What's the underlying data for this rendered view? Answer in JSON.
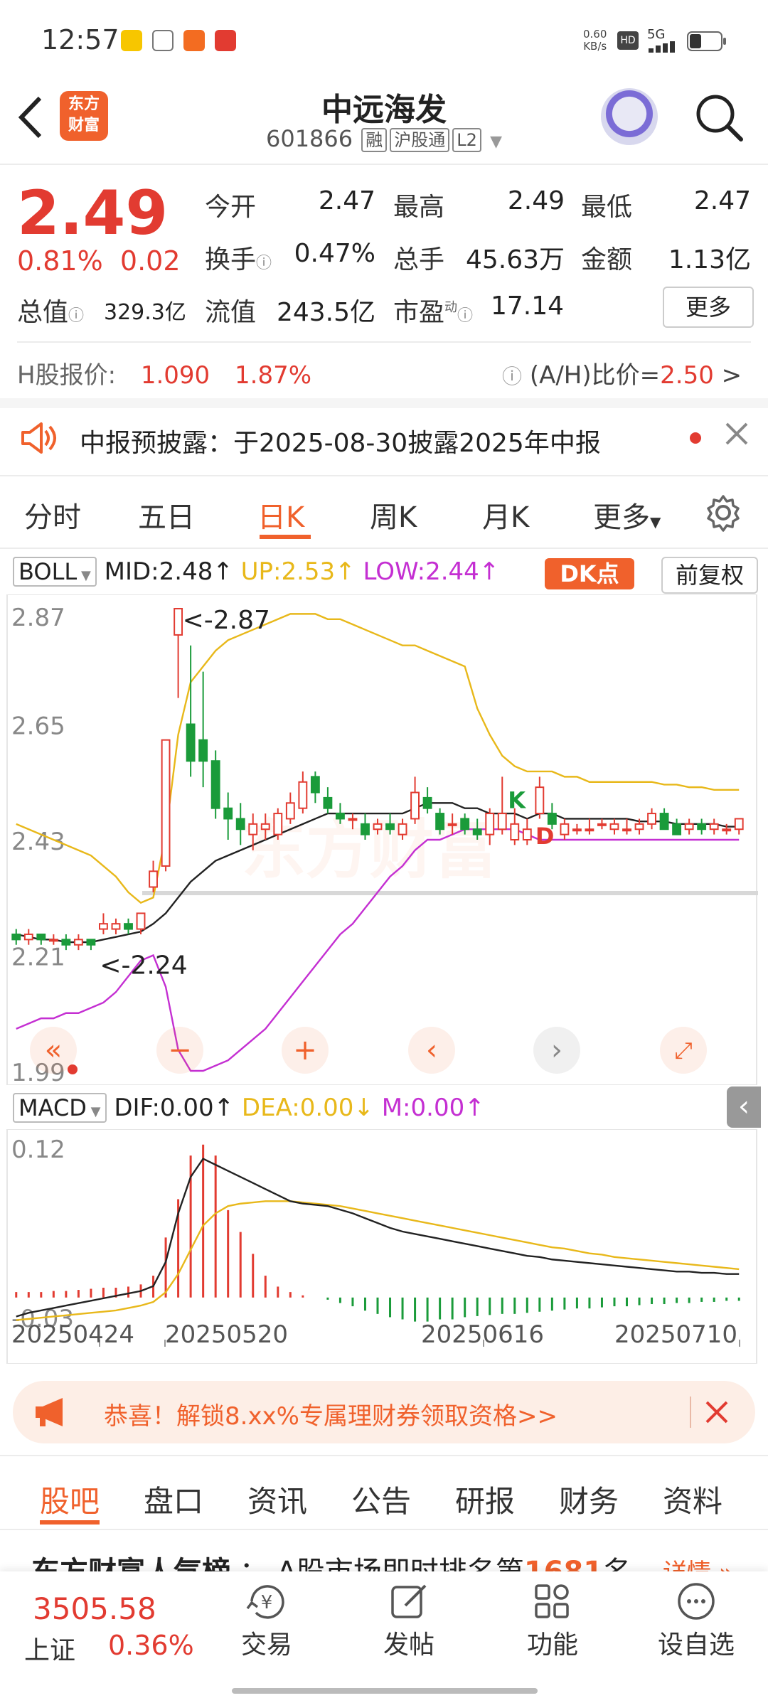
{
  "status": {
    "time": "12:57",
    "net_speed_top": "0.60",
    "net_speed_bottom": "KB/s",
    "hd": "HD",
    "net": "5G"
  },
  "header": {
    "back_label": "<",
    "logo_line1": "东方",
    "logo_line2": "财富",
    "title": "中远海发",
    "code": "601866",
    "tag1": "融",
    "tag2": "沪股通",
    "tag3": "L2"
  },
  "quote": {
    "price": "2.49",
    "pct": "0.81%",
    "chg": "0.02",
    "open_label": "今开",
    "open": "2.47",
    "high_label": "最高",
    "high": "2.49",
    "low_label": "最低",
    "low": "2.47",
    "turnover_label": "换手",
    "turnover": "0.47%",
    "volume_label": "总手",
    "volume": "45.63万",
    "amount_label": "金额",
    "amount": "1.13亿",
    "mktcap_label": "总值",
    "mktcap": "329.3亿",
    "float_label": "流值",
    "float": "243.5亿",
    "pe_label": "市盈",
    "pe_sup": "动",
    "pe": "17.14",
    "more": "更多"
  },
  "hshare": {
    "label": "H股报价:",
    "price": "1.090",
    "pct": "1.87%",
    "ah_label": "(A/H)比价=",
    "ah_value": "2.50",
    "arrow": ">"
  },
  "notice": {
    "text": "中报预披露：于2025-08-30披露2025年中报"
  },
  "ktabs": [
    "分时",
    "五日",
    "日K",
    "周K",
    "月K",
    "更多"
  ],
  "boll": {
    "name": "BOLL",
    "mid": "MID:2.48",
    "up": "UP:2.53",
    "low": "LOW:2.44",
    "dk": "DK点",
    "fq": "前复权"
  },
  "chart_data": [
    {
      "type": "candlestick",
      "title": "BOLL",
      "y_ticks": [
        "2.87",
        "2.65",
        "2.43",
        "2.21",
        "1.99"
      ],
      "ylim": [
        1.99,
        2.87
      ],
      "annotations": [
        "<-2.87",
        "<-2.24",
        "K",
        "D"
      ],
      "candles": [
        {
          "o": 2.25,
          "c": 2.24,
          "h": 2.26,
          "l": 2.23
        },
        {
          "o": 2.24,
          "c": 2.25,
          "h": 2.26,
          "l": 2.23
        },
        {
          "o": 2.25,
          "c": 2.24,
          "h": 2.25,
          "l": 2.23
        },
        {
          "o": 2.24,
          "c": 2.24,
          "h": 2.25,
          "l": 2.23
        },
        {
          "o": 2.24,
          "c": 2.23,
          "h": 2.25,
          "l": 2.22
        },
        {
          "o": 2.23,
          "c": 2.24,
          "h": 2.25,
          "l": 2.22
        },
        {
          "o": 2.24,
          "c": 2.23,
          "h": 2.24,
          "l": 2.22
        },
        {
          "o": 2.26,
          "c": 2.27,
          "h": 2.29,
          "l": 2.25
        },
        {
          "o": 2.26,
          "c": 2.27,
          "h": 2.28,
          "l": 2.25
        },
        {
          "o": 2.27,
          "c": 2.26,
          "h": 2.28,
          "l": 2.25
        },
        {
          "o": 2.26,
          "c": 2.29,
          "h": 2.29,
          "l": 2.25
        },
        {
          "o": 2.34,
          "c": 2.37,
          "h": 2.39,
          "l": 2.33
        },
        {
          "o": 2.38,
          "c": 2.62,
          "h": 2.62,
          "l": 2.37
        },
        {
          "o": 2.82,
          "c": 2.87,
          "h": 2.87,
          "l": 2.7
        },
        {
          "o": 2.65,
          "c": 2.58,
          "h": 2.8,
          "l": 2.55
        },
        {
          "o": 2.62,
          "c": 2.58,
          "h": 2.75,
          "l": 2.53
        },
        {
          "o": 2.58,
          "c": 2.49,
          "h": 2.6,
          "l": 2.47
        },
        {
          "o": 2.49,
          "c": 2.47,
          "h": 2.52,
          "l": 2.43
        },
        {
          "o": 2.47,
          "c": 2.45,
          "h": 2.5,
          "l": 2.42
        },
        {
          "o": 2.44,
          "c": 2.46,
          "h": 2.48,
          "l": 2.41
        },
        {
          "o": 2.45,
          "c": 2.46,
          "h": 2.48,
          "l": 2.43
        },
        {
          "o": 2.44,
          "c": 2.48,
          "h": 2.49,
          "l": 2.43
        },
        {
          "o": 2.47,
          "c": 2.5,
          "h": 2.52,
          "l": 2.46
        },
        {
          "o": 2.49,
          "c": 2.54,
          "h": 2.56,
          "l": 2.48
        },
        {
          "o": 2.55,
          "c": 2.52,
          "h": 2.56,
          "l": 2.5
        },
        {
          "o": 2.51,
          "c": 2.49,
          "h": 2.53,
          "l": 2.48
        },
        {
          "o": 2.48,
          "c": 2.47,
          "h": 2.5,
          "l": 2.46
        },
        {
          "o": 2.47,
          "c": 2.47,
          "h": 2.48,
          "l": 2.45
        },
        {
          "o": 2.46,
          "c": 2.44,
          "h": 2.48,
          "l": 2.43
        },
        {
          "o": 2.45,
          "c": 2.46,
          "h": 2.47,
          "l": 2.44
        },
        {
          "o": 2.46,
          "c": 2.45,
          "h": 2.48,
          "l": 2.44
        },
        {
          "o": 2.44,
          "c": 2.46,
          "h": 2.47,
          "l": 2.43
        },
        {
          "o": 2.47,
          "c": 2.52,
          "h": 2.55,
          "l": 2.46
        },
        {
          "o": 2.51,
          "c": 2.49,
          "h": 2.53,
          "l": 2.48
        },
        {
          "o": 2.48,
          "c": 2.45,
          "h": 2.49,
          "l": 2.44
        },
        {
          "o": 2.46,
          "c": 2.46,
          "h": 2.48,
          "l": 2.44
        },
        {
          "o": 2.47,
          "c": 2.45,
          "h": 2.48,
          "l": 2.44
        },
        {
          "o": 2.45,
          "c": 2.44,
          "h": 2.47,
          "l": 2.43
        },
        {
          "o": 2.44,
          "c": 2.48,
          "h": 2.49,
          "l": 2.42
        },
        {
          "o": 2.45,
          "c": 2.48,
          "h": 2.55,
          "l": 2.44
        },
        {
          "o": 2.43,
          "c": 2.46,
          "h": 2.49,
          "l": 2.42
        },
        {
          "o": 2.43,
          "c": 2.45,
          "h": 2.47,
          "l": 2.42
        },
        {
          "o": 2.48,
          "c": 2.53,
          "h": 2.55,
          "l": 2.47
        },
        {
          "o": 2.48,
          "c": 2.46,
          "h": 2.5,
          "l": 2.45
        },
        {
          "o": 2.44,
          "c": 2.46,
          "h": 2.47,
          "l": 2.43
        },
        {
          "o": 2.45,
          "c": 2.45,
          "h": 2.46,
          "l": 2.44
        },
        {
          "o": 2.45,
          "c": 2.45,
          "h": 2.47,
          "l": 2.44
        },
        {
          "o": 2.46,
          "c": 2.46,
          "h": 2.47,
          "l": 2.45
        },
        {
          "o": 2.45,
          "c": 2.46,
          "h": 2.47,
          "l": 2.44
        },
        {
          "o": 2.45,
          "c": 2.45,
          "h": 2.47,
          "l": 2.44
        },
        {
          "o": 2.45,
          "c": 2.46,
          "h": 2.47,
          "l": 2.44
        },
        {
          "o": 2.46,
          "c": 2.48,
          "h": 2.49,
          "l": 2.45
        },
        {
          "o": 2.48,
          "c": 2.45,
          "h": 2.49,
          "l": 2.45
        },
        {
          "o": 2.46,
          "c": 2.44,
          "h": 2.47,
          "l": 2.44
        },
        {
          "o": 2.45,
          "c": 2.46,
          "h": 2.47,
          "l": 2.44
        },
        {
          "o": 2.46,
          "c": 2.45,
          "h": 2.47,
          "l": 2.44
        },
        {
          "o": 2.45,
          "c": 2.46,
          "h": 2.47,
          "l": 2.44
        },
        {
          "o": 2.45,
          "c": 2.45,
          "h": 2.46,
          "l": 2.44
        },
        {
          "o": 2.45,
          "c": 2.47,
          "h": 2.47,
          "l": 2.44
        }
      ],
      "mid": [
        2.25,
        2.245,
        2.24,
        2.24,
        2.235,
        2.235,
        2.235,
        2.24,
        2.245,
        2.25,
        2.255,
        2.27,
        2.29,
        2.32,
        2.35,
        2.37,
        2.39,
        2.4,
        2.41,
        2.42,
        2.43,
        2.44,
        2.45,
        2.46,
        2.47,
        2.48,
        2.48,
        2.48,
        2.48,
        2.48,
        2.48,
        2.48,
        2.49,
        2.5,
        2.5,
        2.5,
        2.49,
        2.49,
        2.48,
        2.48,
        2.48,
        2.47,
        2.48,
        2.48,
        2.47,
        2.47,
        2.47,
        2.47,
        2.47,
        2.47,
        2.465,
        2.465,
        2.465,
        2.46,
        2.46,
        2.46,
        2.46,
        2.455,
        2.455
      ],
      "up": [
        2.46,
        2.45,
        2.44,
        2.43,
        2.42,
        2.41,
        2.4,
        2.38,
        2.36,
        2.33,
        2.31,
        2.32,
        2.44,
        2.63,
        2.73,
        2.76,
        2.79,
        2.81,
        2.82,
        2.83,
        2.84,
        2.85,
        2.86,
        2.86,
        2.86,
        2.85,
        2.85,
        2.84,
        2.83,
        2.82,
        2.81,
        2.8,
        2.8,
        2.79,
        2.78,
        2.77,
        2.76,
        2.68,
        2.63,
        2.59,
        2.57,
        2.56,
        2.56,
        2.56,
        2.55,
        2.55,
        2.54,
        2.54,
        2.54,
        2.54,
        2.54,
        2.54,
        2.535,
        2.535,
        2.53,
        2.53,
        2.525,
        2.525,
        2.525
      ],
      "low": [
        2.07,
        2.08,
        2.09,
        2.09,
        2.1,
        2.1,
        2.11,
        2.12,
        2.14,
        2.17,
        2.2,
        2.21,
        2.15,
        2.03,
        1.99,
        1.99,
        2.0,
        2.01,
        2.03,
        2.05,
        2.07,
        2.1,
        2.13,
        2.16,
        2.19,
        2.22,
        2.25,
        2.27,
        2.3,
        2.33,
        2.36,
        2.38,
        2.41,
        2.43,
        2.43,
        2.44,
        2.45,
        2.45,
        2.45,
        2.45,
        2.45,
        2.44,
        2.43,
        2.43,
        2.43,
        2.43,
        2.43,
        2.43,
        2.43,
        2.43,
        2.43,
        2.43,
        2.43,
        2.43,
        2.43,
        2.43,
        2.43,
        2.43,
        2.43
      ]
    },
    {
      "type": "bar",
      "title": "MACD",
      "y_ticks": [
        "0.12",
        "-0.03"
      ],
      "ylim": [
        -0.03,
        0.12
      ],
      "x_labels": [
        "20250424",
        "20250520",
        "20250616",
        "20250710"
      ],
      "macd": [
        0.005,
        0.005,
        0.005,
        0.006,
        0.006,
        0.007,
        0.008,
        0.009,
        0.009,
        0.01,
        0.012,
        0.02,
        0.055,
        0.09,
        0.13,
        0.14,
        0.13,
        0.08,
        0.06,
        0.04,
        0.02,
        0.01,
        0.005,
        0.002,
        0.0,
        -0.002,
        -0.005,
        -0.008,
        -0.012,
        -0.015,
        -0.018,
        -0.02,
        -0.022,
        -0.022,
        -0.02,
        -0.02,
        -0.018,
        -0.017,
        -0.016,
        -0.015,
        -0.015,
        -0.014,
        -0.013,
        -0.012,
        -0.011,
        -0.01,
        -0.01,
        -0.009,
        -0.008,
        -0.008,
        -0.007,
        -0.006,
        -0.006,
        -0.005,
        -0.005,
        -0.004,
        -0.004,
        -0.003,
        -0.003
      ],
      "dif": [
        -0.025,
        -0.022,
        -0.02,
        -0.018,
        -0.016,
        -0.014,
        -0.012,
        -0.01,
        -0.008,
        -0.006,
        -0.004,
        0.0,
        0.02,
        0.06,
        0.09,
        0.105,
        0.1,
        0.095,
        0.09,
        0.085,
        0.08,
        0.075,
        0.07,
        0.068,
        0.067,
        0.066,
        0.063,
        0.06,
        0.056,
        0.052,
        0.048,
        0.045,
        0.043,
        0.041,
        0.039,
        0.037,
        0.035,
        0.033,
        0.031,
        0.029,
        0.027,
        0.025,
        0.024,
        0.022,
        0.021,
        0.02,
        0.019,
        0.018,
        0.017,
        0.016,
        0.015,
        0.014,
        0.013,
        0.012,
        0.012,
        0.011,
        0.011,
        0.01,
        0.01
      ],
      "dea": [
        -0.028,
        -0.027,
        -0.026,
        -0.025,
        -0.024,
        -0.023,
        -0.022,
        -0.021,
        -0.02,
        -0.018,
        -0.016,
        -0.013,
        -0.005,
        0.01,
        0.03,
        0.05,
        0.06,
        0.066,
        0.068,
        0.069,
        0.07,
        0.07,
        0.07,
        0.069,
        0.068,
        0.067,
        0.066,
        0.064,
        0.062,
        0.06,
        0.058,
        0.056,
        0.054,
        0.052,
        0.05,
        0.048,
        0.046,
        0.044,
        0.042,
        0.04,
        0.038,
        0.036,
        0.034,
        0.032,
        0.031,
        0.029,
        0.027,
        0.026,
        0.024,
        0.023,
        0.022,
        0.021,
        0.02,
        0.019,
        0.018,
        0.017,
        0.016,
        0.015,
        0.014
      ]
    }
  ],
  "macd_hdr": {
    "name": "MACD",
    "dif": "DIF:0.00",
    "dea": "DEA:0.00",
    "m": "M:0.00"
  },
  "banner": {
    "text": "恭喜！解锁8.xx%专属理财券领取资格>>"
  },
  "btabs": [
    "股吧",
    "盘口",
    "资讯",
    "公告",
    "研报",
    "财务",
    "资料"
  ],
  "rank": {
    "text_a": "东方财富人气榜",
    "text_b": "A股市场即时排名第",
    "rank": "1681",
    "text_c": "名",
    "more": "详情"
  },
  "footer": {
    "index_value": "3505.58",
    "index_name": "上证",
    "index_pct": "0.36%",
    "trade": "交易",
    "post": "发帖",
    "func": "功能",
    "watch": "设自选"
  },
  "colors": {
    "accent": "#f0612c",
    "up": "#e23b31",
    "down": "#1a9b3a",
    "boll_mid": "#222222",
    "boll_up": "#e8b81a",
    "boll_low": "#c42fd2"
  }
}
